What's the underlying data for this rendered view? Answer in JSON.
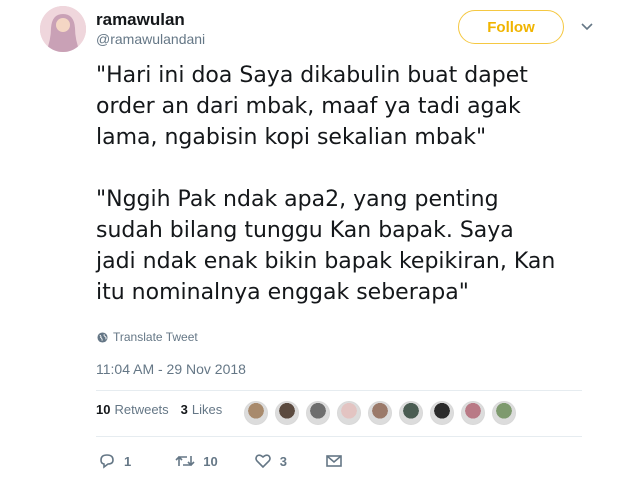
{
  "user": {
    "display_name": "ramawulan",
    "handle": "@ramawulandani"
  },
  "follow_button": {
    "label": "Follow",
    "color": "#f0b400"
  },
  "tweet": {
    "paragraphs": [
      "\"Hari ini doa Saya dikabulin buat dapet order an dari mbak, maaf ya tadi agak lama, ngabisin kopi sekalian mbak\"",
      "\"Nggih Pak ndak apa2, yang penting sudah bilang tunggu Kan bapak. Saya jadi ndak enak bikin bapak kepikiran, Kan itu nominalnya enggak seberapa\""
    ],
    "translate_label": "Translate Tweet",
    "timestamp": "11:04 AM - 29 Nov 2018"
  },
  "stats": {
    "retweets_count": "10",
    "retweets_label": "Retweets",
    "likes_count": "3",
    "likes_label": "Likes"
  },
  "likers": [
    {
      "color": "#a88a6c"
    },
    {
      "color": "#5b4a3f"
    },
    {
      "color": "#6e6e6e"
    },
    {
      "color": "#e3c4c2"
    },
    {
      "color": "#9b7a6a"
    },
    {
      "color": "#4a5c52"
    },
    {
      "color": "#2b2b2b"
    },
    {
      "color": "#b97a86"
    },
    {
      "color": "#7e9a6e"
    }
  ],
  "actions": {
    "reply_count": "1",
    "retweet_count": "10",
    "like_count": "3"
  },
  "icons": {
    "caret": "chevron-down-icon",
    "globe": "globe-icon",
    "reply": "reply-icon",
    "retweet": "retweet-icon",
    "like": "heart-icon",
    "message": "envelope-icon"
  }
}
